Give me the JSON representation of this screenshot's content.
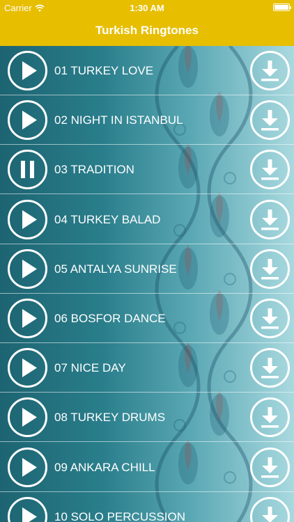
{
  "status": {
    "carrier": "Carrier",
    "time": "1:30 AM"
  },
  "nav": {
    "title": "Turkish Ringtones"
  },
  "tracks": [
    {
      "title": "01 TURKEY LOVE",
      "state": "play"
    },
    {
      "title": "02 NIGHT IN ISTANBUL",
      "state": "play"
    },
    {
      "title": "03 TRADITION",
      "state": "pause"
    },
    {
      "title": "04 TURKEY BALAD",
      "state": "play"
    },
    {
      "title": "05 ANTALYA SUNRISE",
      "state": "play"
    },
    {
      "title": "06 BOSFOR DANCE",
      "state": "play"
    },
    {
      "title": "07 NICE DAY",
      "state": "play"
    },
    {
      "title": "08 TURKEY DRUMS",
      "state": "play"
    },
    {
      "title": "09 ANKARA CHILL",
      "state": "play"
    },
    {
      "title": "10 SOLO PERCUSSION",
      "state": "play"
    }
  ],
  "colors": {
    "accent": "#e7be00",
    "background": "#1f6b78"
  },
  "icons": {
    "play": "play-icon",
    "pause": "pause-icon",
    "download": "download-icon",
    "wifi": "wifi-icon",
    "battery": "battery-icon"
  }
}
